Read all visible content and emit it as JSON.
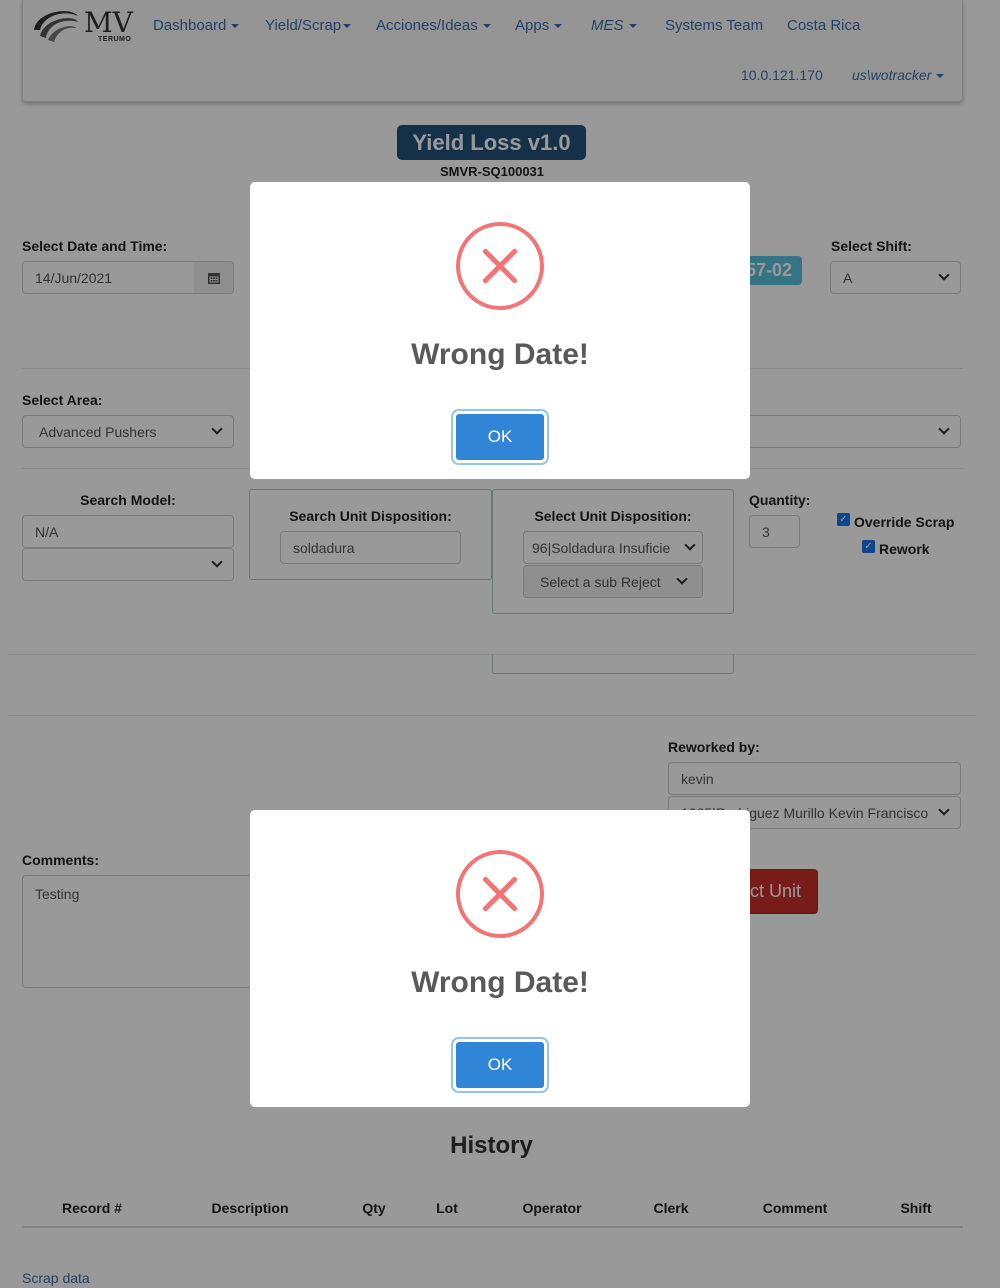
{
  "nav": {
    "items": [
      {
        "label": "Dashboard",
        "caret": true,
        "italic": false
      },
      {
        "label": "Yield/Scrap",
        "caret": true,
        "italic": false
      },
      {
        "label": "Acciones/Ideas",
        "caret": true,
        "italic": false
      },
      {
        "label": "Apps",
        "caret": true,
        "italic": false
      },
      {
        "label": "MES",
        "caret": true,
        "italic": true
      },
      {
        "label": "Systems Team",
        "caret": false,
        "italic": false
      },
      {
        "label": "Costa Rica",
        "caret": false,
        "italic": false
      }
    ],
    "ip": "10.0.121.170",
    "user": "us\\wotracker",
    "logo_text": "MV",
    "logo_sub": "TERUMO"
  },
  "header": {
    "title": "Yield Loss v1.0",
    "subtitle": "SMVR-SQ100031"
  },
  "form": {
    "date_label": "Select Date and Time:",
    "date_value": "14/Jun/2021",
    "lot_badge": "57-02",
    "shift_label": "Select Shift:",
    "shift_value": "A",
    "area_label": "Select Area:",
    "area_value": "Advanced Pushers",
    "search_model_label": "Search Model:",
    "search_model_value": "N/A",
    "search_disp_label": "Search Unit Disposition:",
    "search_disp_value": "soldadura",
    "select_disp_label": "Select Unit Disposition:",
    "select_disp_value": "96|Soldadura Insuficie",
    "sub_reject_value": "Select a sub Reject",
    "quantity_label": "Quantity:",
    "quantity_value": "3",
    "override_label": "Override Scrap",
    "rework_label": "Rework",
    "reworked_by_label": "Reworked by:",
    "reworked_by_value": "kevin",
    "reworked_by_select": "1085|Rodriguez Murillo Kevin Francisco",
    "comments_label": "Comments:",
    "comments_value": "Testing",
    "reject_button_partial": "ct Unit"
  },
  "history": {
    "title": "History",
    "columns": [
      "Record #",
      "Description",
      "Qty",
      "Lot",
      "Operator",
      "Clerk",
      "Comment",
      "Shift"
    ],
    "link": "Scrap data"
  },
  "dialogs": [
    {
      "title": "Wrong Date!",
      "ok": "OK"
    },
    {
      "title": "Wrong Date!",
      "ok": "OK"
    }
  ],
  "colors": {
    "nav_link": "#3a6fa8",
    "title_badge": "#23527c",
    "lot_badge": "#5bc0de",
    "danger": "#c9302c",
    "error_icon": "#f27474",
    "ok_button": "#3085d6"
  }
}
